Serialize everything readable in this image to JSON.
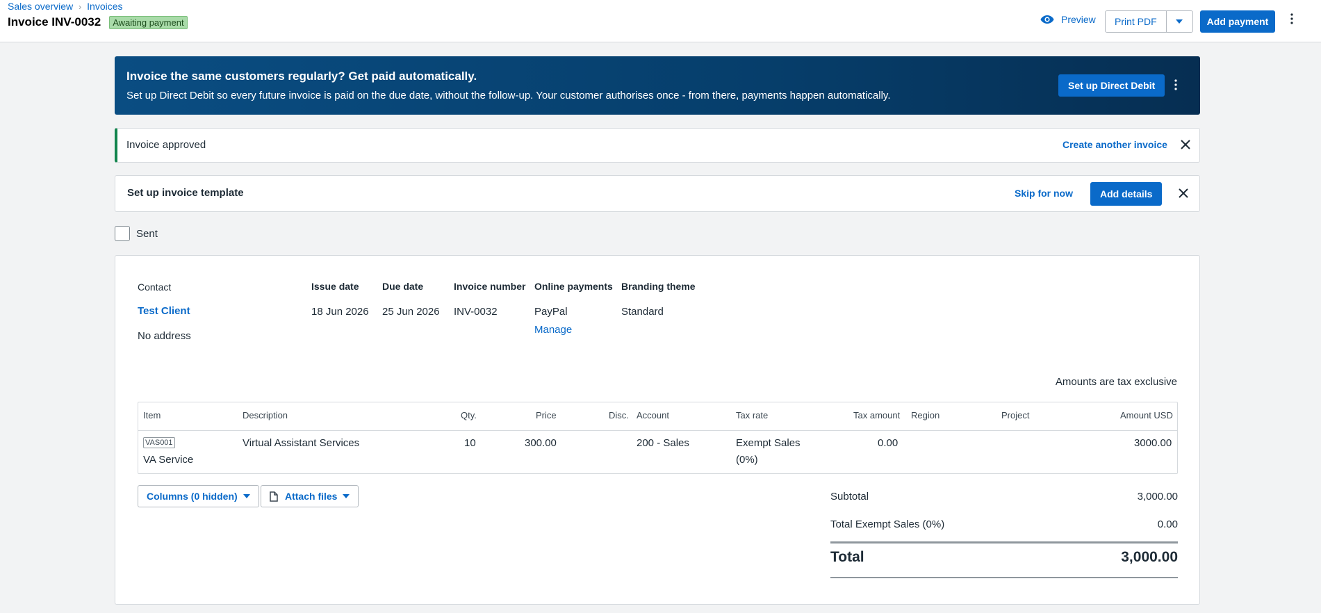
{
  "breadcrumb": [
    "Sales overview",
    "Invoices"
  ],
  "header": {
    "title": "Invoice INV-0032",
    "status": "Awaiting payment",
    "preview_label": "Preview",
    "print_label": "Print PDF",
    "add_payment_label": "Add payment"
  },
  "direct_debit": {
    "title": "Invoice the same customers regularly? Get paid automatically.",
    "text": "Set up Direct Debit so every future invoice is paid on the due date, without the follow-up. Your customer authorises once - from there, payments happen automatically.",
    "button": "Set up Direct Debit"
  },
  "approved": {
    "text": "Invoice approved",
    "link": "Create another invoice"
  },
  "template": {
    "title": "Set up invoice template",
    "skip": "Skip for now",
    "button": "Add details"
  },
  "sent": {
    "label": "Sent",
    "checked": false
  },
  "invoice": {
    "contact_label": "Contact",
    "contact_name": "Test Client",
    "contact_address": "No address",
    "issue_date_label": "Issue date",
    "issue_date": "18 Jun 2026",
    "due_date_label": "Due date",
    "due_date": "25 Jun 2026",
    "number_label": "Invoice number",
    "number": "INV-0032",
    "online_payments_label": "Online payments",
    "online_payments": "PayPal",
    "manage": "Manage",
    "branding_label": "Branding theme",
    "branding": "Standard",
    "tax_note": "Amounts are tax exclusive"
  },
  "line_items": {
    "columns": [
      "Item",
      "Description",
      "Qty.",
      "Price",
      "Disc.",
      "Account",
      "Tax rate",
      "Tax amount",
      "Region",
      "Project",
      "Amount USD"
    ],
    "rows": [
      {
        "code": "VAS001",
        "item": "VA Service",
        "description": "Virtual Assistant Services",
        "qty": "10",
        "price": "300.00",
        "disc": "",
        "account": "200 - Sales",
        "tax_rate_1": "Exempt Sales",
        "tax_rate_2": "(0%)",
        "tax_amount": "0.00",
        "region": "",
        "project": "",
        "amount": "3000.00"
      }
    ]
  },
  "actions": {
    "columns": "Columns (0 hidden)",
    "attach": "Attach files"
  },
  "totals": {
    "subtotal_label": "Subtotal",
    "subtotal": "3,000.00",
    "tax_label": "Total Exempt Sales (0%)",
    "tax": "0.00",
    "total_label": "Total",
    "total": "3,000.00"
  },
  "colors": {
    "accent": "#0a6ac9",
    "banner": "#063e6b",
    "success": "#13854e",
    "status_badge": "#a9dba9"
  }
}
